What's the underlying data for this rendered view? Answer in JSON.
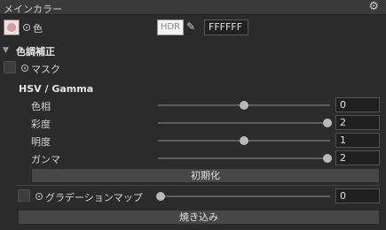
{
  "header": {
    "title": "メインカラー",
    "gear_icon": "gear-icon"
  },
  "color_row": {
    "label": "色",
    "hdr_label": "HDR",
    "hex_value": "FFFFFF",
    "swatch_color": "#ffffff"
  },
  "correction": {
    "title": "色調補正",
    "mask_label": "マスク",
    "hsv_title": "HSV / Gamma",
    "sliders": [
      {
        "label": "色相",
        "value": "0",
        "level": 0.5
      },
      {
        "label": "彩度",
        "value": "2",
        "level": 1.0
      },
      {
        "label": "明度",
        "value": "1",
        "level": 0.5
      },
      {
        "label": "ガンマ",
        "value": "2",
        "level": 1.0
      }
    ],
    "reset_label": "初期化",
    "gradient_map": {
      "label": "グラデーションマップ",
      "value": "0",
      "level": 0.0
    },
    "bake_label": "焼き込み"
  }
}
